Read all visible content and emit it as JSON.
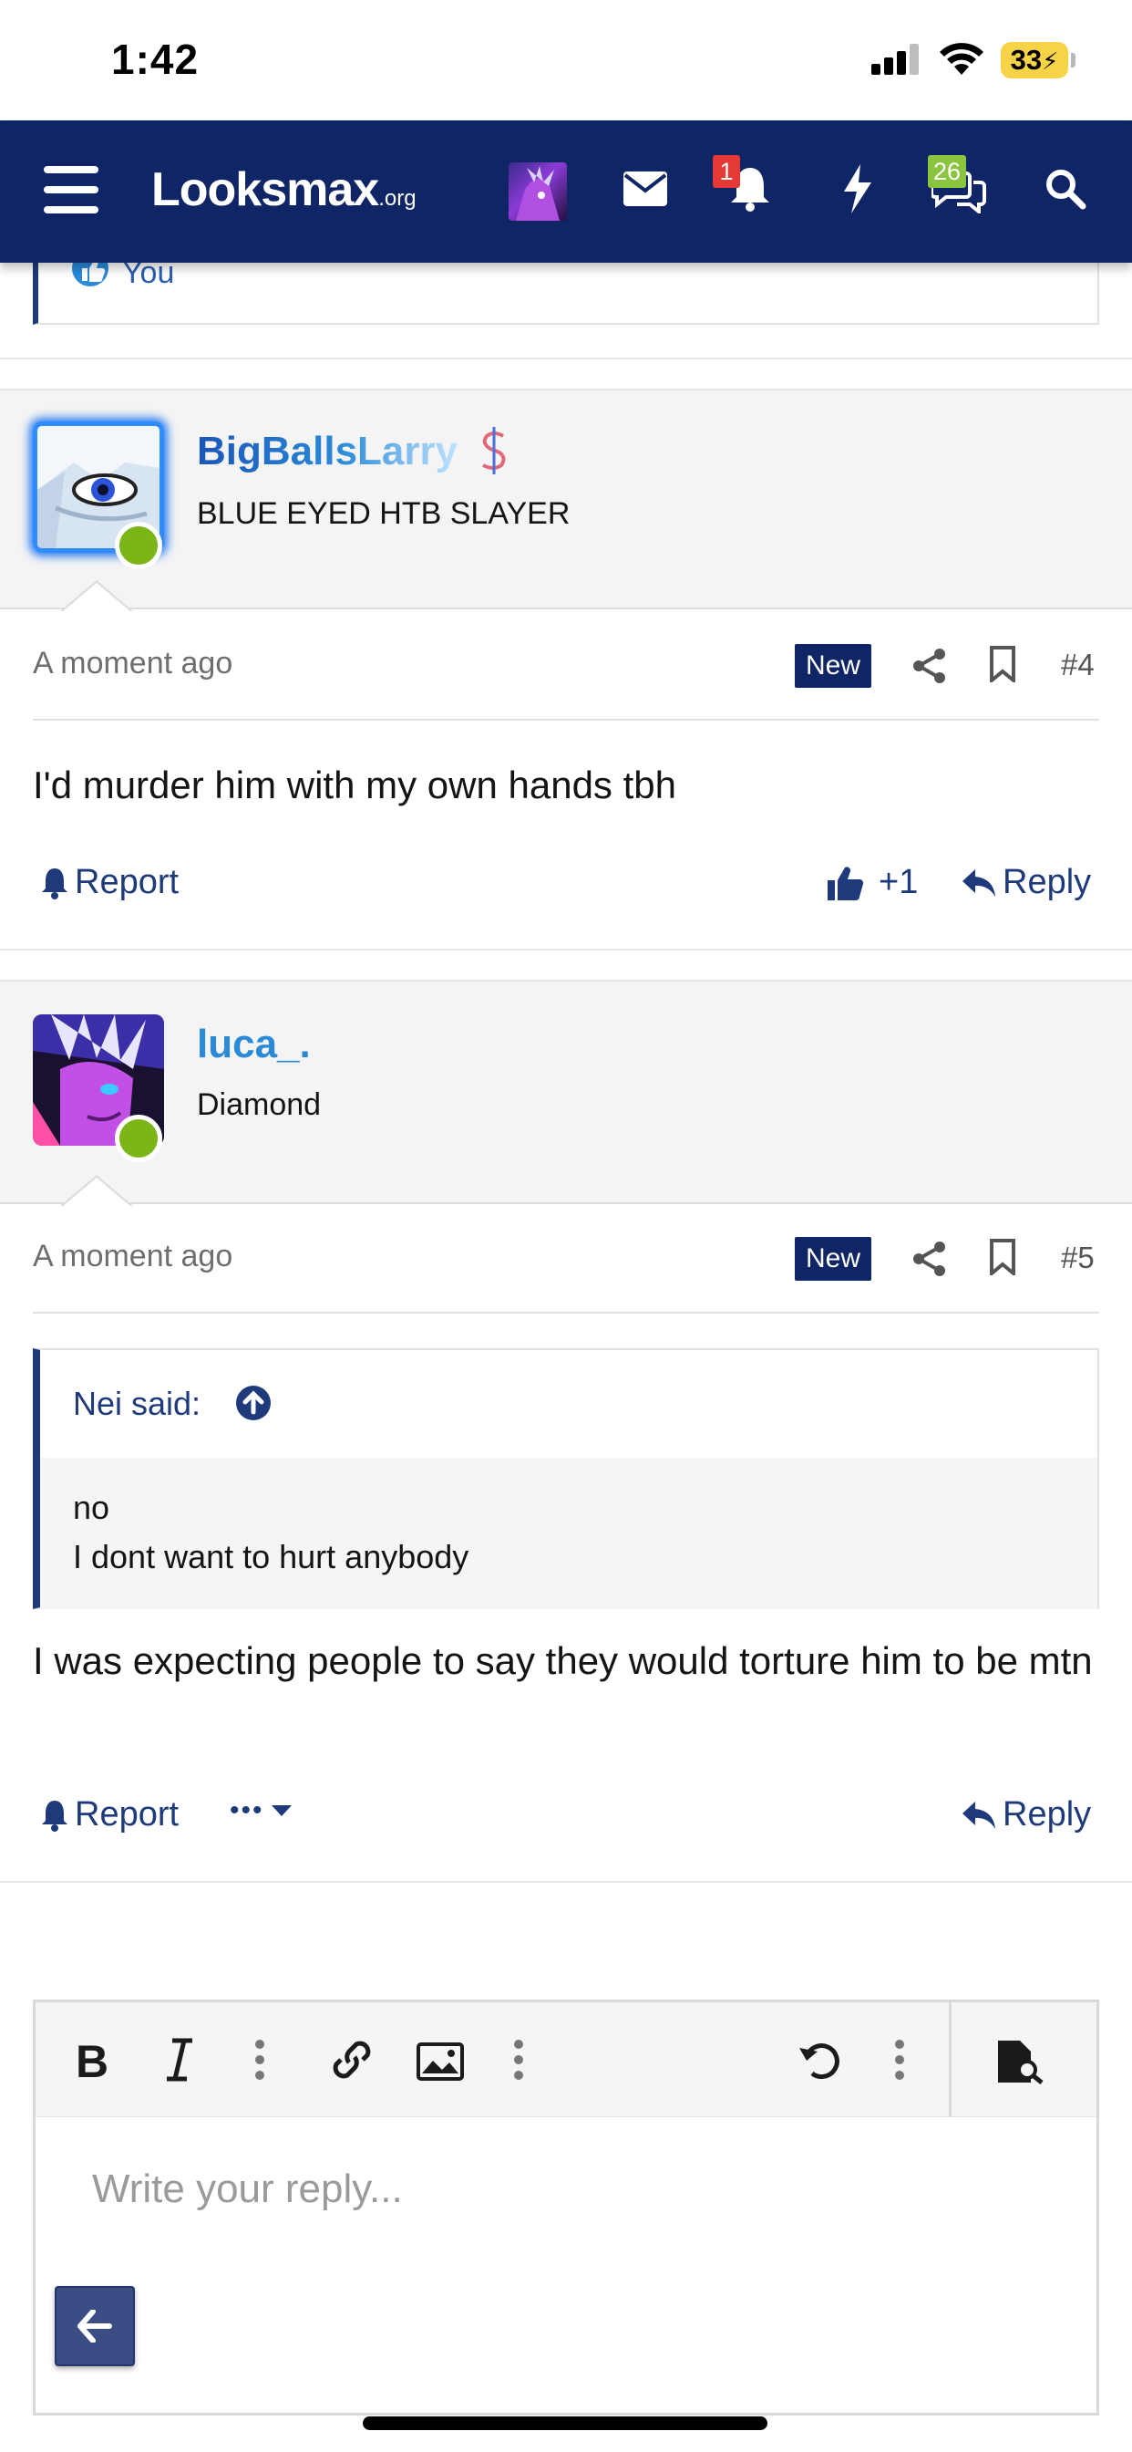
{
  "status_bar": {
    "time": "1:42",
    "battery": "33"
  },
  "nav": {
    "logo": "Looksmax",
    "logo_suffix": ".org",
    "icons": [
      "menu-icon",
      "envelope-icon",
      "bell-icon",
      "bolt-icon",
      "chat-icon",
      "search-icon"
    ],
    "alerts_badge": "1",
    "conversations_badge": "26",
    "colors": {
      "bar": "#0f2566",
      "alert_badge": "#e53935",
      "conv_badge": "#8bc43f"
    }
  },
  "previous_post": {
    "reaction_label": "You"
  },
  "posts": [
    {
      "username": "BigBallsLarry",
      "user_title": "BLUE EYED HTB SLAYER",
      "timestamp": "A moment ago",
      "new_label": "New",
      "post_number": "#4",
      "body": "I'd murder him with my own hands tbh",
      "report_label": "Report",
      "like_label": "+1",
      "reply_label": "Reply"
    },
    {
      "username": "luca_.",
      "user_title": "Diamond",
      "timestamp": "A moment ago",
      "new_label": "New",
      "post_number": "#5",
      "quote": {
        "author_label": "Nei said:",
        "line1": "no",
        "line2": "I dont want to hurt anybody"
      },
      "body": "I was expecting people to say they would torture him to be mtn",
      "report_label": "Report",
      "more_label": "•••",
      "reply_label": "Reply"
    }
  ],
  "editor": {
    "placeholder": "Write your reply...",
    "toolbar": [
      "bold-icon",
      "italic-icon",
      "more-options-icon",
      "link-icon",
      "image-icon",
      "more-options-icon",
      "undo-icon",
      "more-options-icon",
      "preview-icon"
    ]
  },
  "accent_color": "#1e3a7b",
  "username_color": "#2a8ad8"
}
